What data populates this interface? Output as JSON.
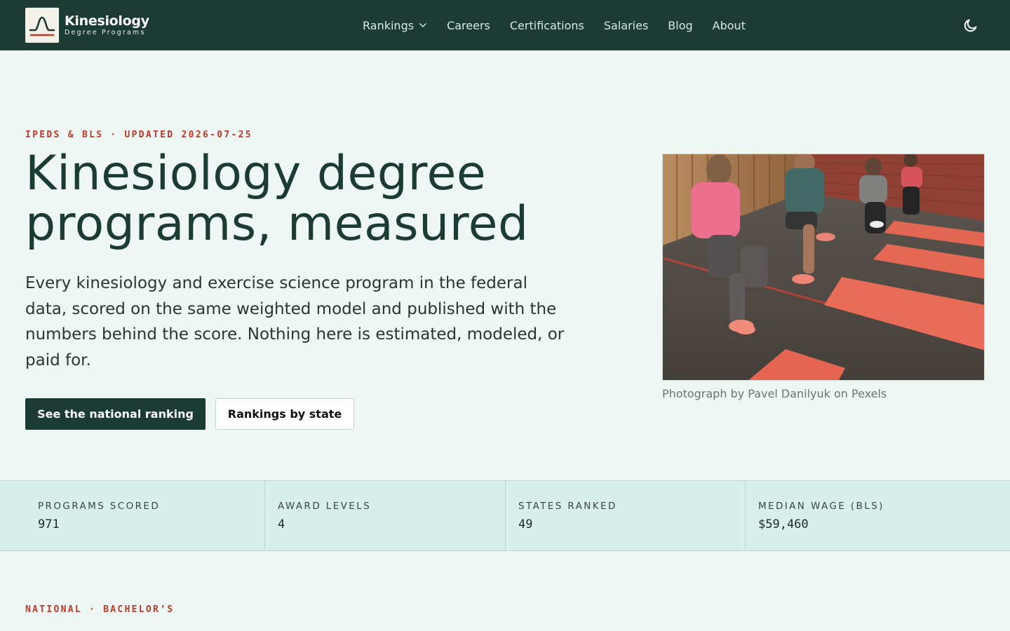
{
  "brand": {
    "name": "Kinesiology",
    "tagline": "Degree Programs",
    "logo_icon": "bell-curve-logo-icon"
  },
  "nav": {
    "items": [
      {
        "label": "Rankings",
        "has_dropdown": true
      },
      {
        "label": "Careers"
      },
      {
        "label": "Certifications"
      },
      {
        "label": "Salaries"
      },
      {
        "label": "Blog"
      },
      {
        "label": "About"
      }
    ],
    "theme_toggle_icon": "moon-icon"
  },
  "hero": {
    "eyebrow_source": "IPEDS & BLS",
    "eyebrow_separator": "·",
    "eyebrow_updated": "UPDATED 2026-07-25",
    "title": "Kinesiology degree programs, measured",
    "lede": "Every kinesiology and exercise science program in the federal data, scored on the same weighted model and published with the numbers behind the score. Nothing here is estimated, modeled, or paid for.",
    "primary_cta": "See the national ranking",
    "secondary_cta": "Rankings by state",
    "photo_caption": "Photograph by Pavel Danilyuk on Pexels"
  },
  "stats": [
    {
      "label": "PROGRAMS SCORED",
      "value": "971"
    },
    {
      "label": "AWARD LEVELS",
      "value": "4"
    },
    {
      "label": "STATES RANKED",
      "value": "49"
    },
    {
      "label": "MEDIAN WAGE (BLS)",
      "value": "$59,460"
    }
  ],
  "next_section": {
    "eyebrow_scope": "NATIONAL",
    "eyebrow_separator": "·",
    "eyebrow_level": "BACHELOR’S"
  },
  "colors": {
    "header_bg": "#1b3b33",
    "page_bg": "#eef7f3",
    "accent": "#c0392b",
    "stats_bg": "#d9efeb"
  }
}
